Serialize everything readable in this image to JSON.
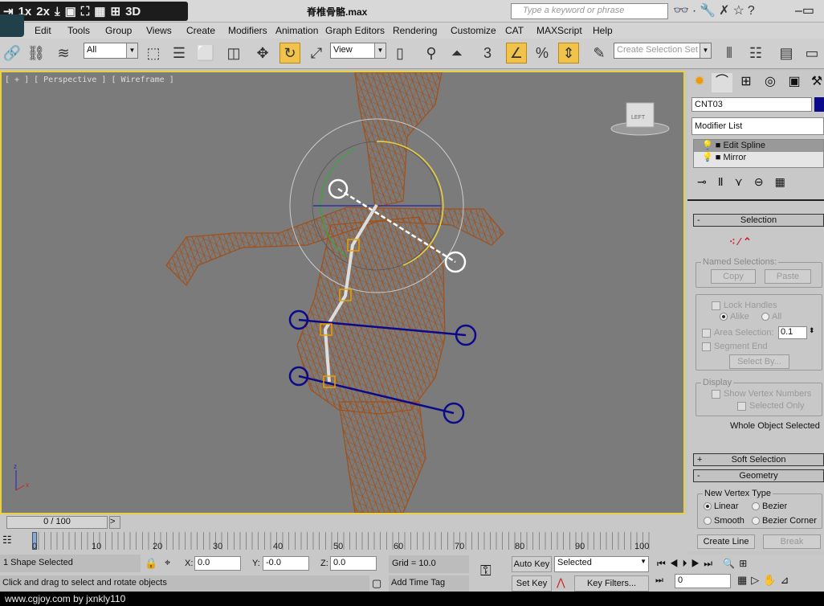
{
  "titlebar": {
    "quick_access": [
      "⇥",
      "1x",
      "2x",
      "⤓",
      "▣",
      "⛶",
      "▦",
      "⊞",
      "3D"
    ],
    "title": "脊椎骨骼.max",
    "search_placeholder": "Type a keyword or phrase",
    "help_icons": "👓·🔧✗☆?",
    "window_controls": "–▭"
  },
  "menu": [
    "Edit",
    "Tools",
    "Group",
    "Views",
    "Create",
    "Modifiers",
    "Animation",
    "Graph Editors",
    "Rendering",
    "Customize",
    "CAT",
    "MAXScript",
    "Help"
  ],
  "toolbar": {
    "selection_filter": "All",
    "reference_coord": "View",
    "named_selection_set": "Create Selection Set",
    "snap_value": "3"
  },
  "viewport": {
    "label": "[ + ] [ Perspective ] [ Wireframe ]",
    "viewcube": "LEFT",
    "wire_color": "#a0501a"
  },
  "command_panel": {
    "object_name": "CNT03",
    "object_color": "#0a0a8a",
    "modifier_list": "Modifier List",
    "stack": [
      "Edit Spline",
      "Mirror"
    ],
    "selection": {
      "title": "Selection",
      "named_selections": "Named Selections:",
      "copy": "Copy",
      "paste": "Paste",
      "lock_handles": "Lock Handles",
      "alike": "Alike",
      "all": "All",
      "area_selection": "Area Selection:",
      "area_value": "0.1",
      "segment_end": "Segment End",
      "select_by": "Select By...",
      "display": "Display",
      "show_vertex_numbers": "Show Vertex Numbers",
      "selected_only": "Selected Only",
      "status": "Whole Object Selected"
    },
    "soft_selection": "Soft Selection",
    "geometry": {
      "title": "Geometry",
      "new_vertex_type": "New Vertex Type",
      "linear": "Linear",
      "bezier": "Bezier",
      "smooth": "Smooth",
      "bezier_corner": "Bezier Corner",
      "create_line": "Create Line",
      "break": "Break"
    }
  },
  "timeline": {
    "frame": "0 / 100",
    "next": ">",
    "ticks": [
      "0",
      "10",
      "20",
      "30",
      "40",
      "50",
      "60",
      "70",
      "80",
      "90",
      "100"
    ],
    "progress": 0
  },
  "status": {
    "selected": "1 Shape Selected",
    "x_label": "X:",
    "x": "0.0",
    "y_label": "Y:",
    "y": "-0.0",
    "z_label": "Z:",
    "z": "0.0",
    "grid": "Grid = 10.0",
    "prompt": "Click and drag to select and rotate objects",
    "add_time_tag": "Add Time Tag",
    "auto_key": "Auto Key",
    "set_key": "Set Key",
    "key_mode": "Selected",
    "key_filters": "Key Filters...",
    "current_frame": "0"
  },
  "watermark": "www.cgjoy.com by jxnkly110"
}
